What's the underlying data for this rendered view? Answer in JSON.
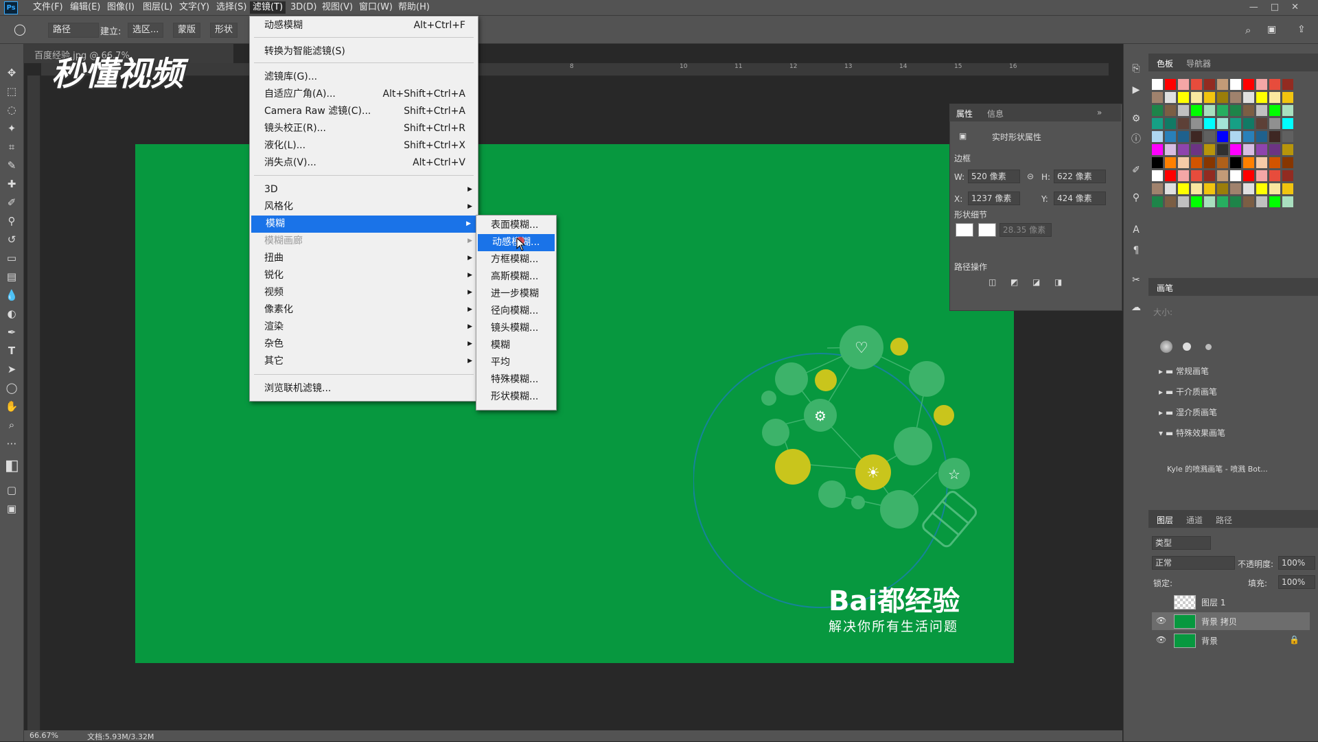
{
  "app": {
    "logo": "Ps"
  },
  "menubar": {
    "items": [
      "文件(F)",
      "编辑(E)",
      "图像(I)",
      "图层(L)",
      "文字(Y)",
      "选择(S)",
      "滤镜(T)",
      "3D(D)",
      "视图(V)",
      "窗口(W)",
      "帮助(H)"
    ],
    "active": "滤镜(T)"
  },
  "window_controls": [
    "—",
    "□",
    "✕"
  ],
  "options_bar": {
    "mode": "路径",
    "build_label": "建立:",
    "selection": "选区...",
    "mask": "蒙版",
    "shape": "形状"
  },
  "document": {
    "tab_title": "百度经验.jpg @ 66.7%",
    "zoom": "66.67%",
    "doc_size": "文档:5.93M/3.32M"
  },
  "ruler_ticks": [
    "8",
    "10",
    "11",
    "12",
    "13",
    "14",
    "15",
    "16"
  ],
  "watermark": "秒懂视频",
  "canvas": {
    "background": "#07983f",
    "brand": "Bai都经验",
    "slogan": "解决你所有生活问题"
  },
  "filter_menu": {
    "items": [
      {
        "label": "动感模糊",
        "shortcut": "Alt+Ctrl+F"
      },
      {
        "label": "转换为智能滤镜(S)",
        "shortcut": ""
      },
      {
        "label": "滤镜库(G)...",
        "shortcut": ""
      },
      {
        "label": "自适应广角(A)...",
        "shortcut": "Alt+Shift+Ctrl+A"
      },
      {
        "label": "Camera Raw 滤镜(C)...",
        "shortcut": "Shift+Ctrl+A"
      },
      {
        "label": "镜头校正(R)...",
        "shortcut": "Shift+Ctrl+R"
      },
      {
        "label": "液化(L)...",
        "shortcut": "Shift+Ctrl+X"
      },
      {
        "label": "消失点(V)...",
        "shortcut": "Alt+Ctrl+V"
      },
      {
        "label": "3D",
        "submenu": true
      },
      {
        "label": "风格化",
        "submenu": true
      },
      {
        "label": "模糊",
        "submenu": true,
        "highlighted": true
      },
      {
        "label": "模糊画廊",
        "submenu": true,
        "disabled": true
      },
      {
        "label": "扭曲",
        "submenu": true
      },
      {
        "label": "锐化",
        "submenu": true
      },
      {
        "label": "视频",
        "submenu": true
      },
      {
        "label": "像素化",
        "submenu": true
      },
      {
        "label": "渲染",
        "submenu": true
      },
      {
        "label": "杂色",
        "submenu": true
      },
      {
        "label": "其它",
        "submenu": true
      },
      {
        "label": "浏览联机滤镜...",
        "shortcut": ""
      }
    ]
  },
  "blur_submenu": {
    "items": [
      "表面模糊...",
      "动感模糊...",
      "方框模糊...",
      "高斯模糊...",
      "进一步模糊",
      "径向模糊...",
      "镜头模糊...",
      "模糊",
      "平均",
      "特殊模糊...",
      "形状模糊..."
    ],
    "highlighted": "动感模糊..."
  },
  "properties": {
    "tabs": [
      "属性",
      "信息"
    ],
    "header": "实时形状属性",
    "section_edges": "边框",
    "w_label": "W:",
    "w_value": "520 像素",
    "h_label": "H:",
    "h_value": "622 像素",
    "x_label": "X:",
    "x_value": "1237 像素",
    "y_label": "Y:",
    "y_value": "424 像素",
    "section_shape": "形状细节",
    "stroke_value": "28.35 像素",
    "section_path": "路径操作"
  },
  "color_panel": {
    "tabs": [
      "色板",
      "导航器"
    ]
  },
  "brush_panel": {
    "tab": "画笔",
    "size_label": "大小:",
    "folders": [
      "常规画笔",
      "干介质画笔",
      "湿介质画笔",
      "特殊效果画笔"
    ],
    "preset": "Kyle 的喷溅画笔 - 喷溅 Bot..."
  },
  "layers_panel": {
    "tabs": [
      "图层",
      "通道",
      "路径"
    ],
    "filter": "类型",
    "blend_mode": "正常",
    "opacity_label": "不透明度:",
    "opacity": "100%",
    "lock_label": "锁定:",
    "fill_label": "填充:",
    "fill": "100%",
    "layers": [
      {
        "name": "图层 1",
        "visible": false
      },
      {
        "name": "背景 拷贝",
        "visible": true,
        "selected": true
      },
      {
        "name": "背景",
        "visible": true,
        "locked": true
      }
    ]
  },
  "colors": {
    "accent": "#1a73e8",
    "canvas_green": "#07983f",
    "ui_gray": "#535353"
  }
}
